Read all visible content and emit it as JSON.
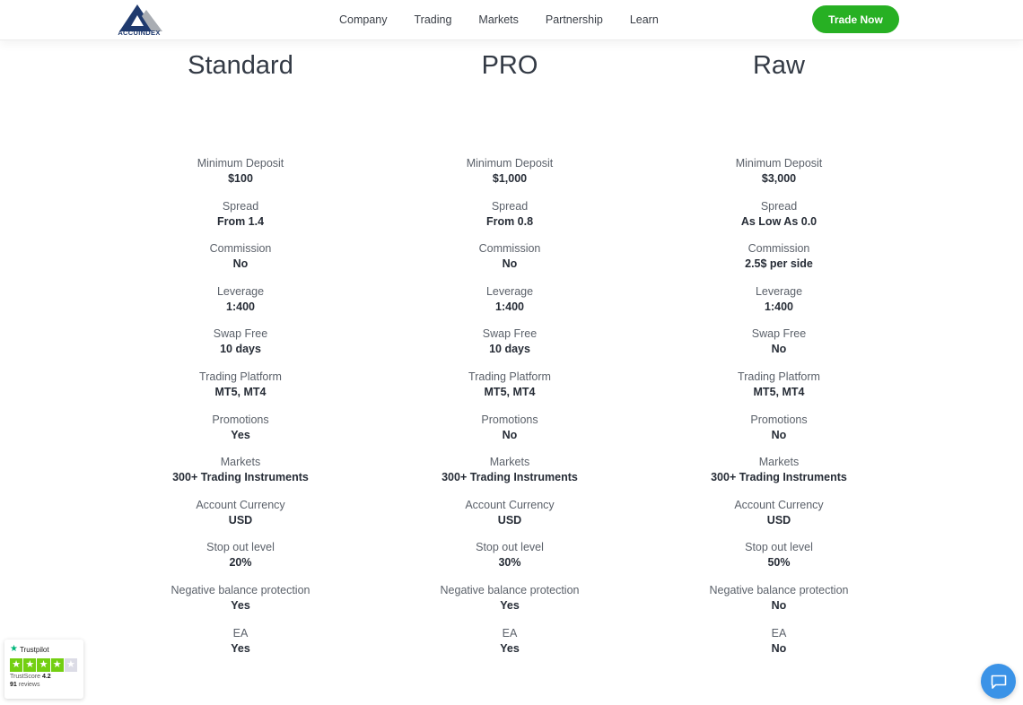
{
  "header": {
    "logo_text": "ACCUINDEX",
    "nav": [
      "Company",
      "Trading",
      "Markets",
      "Partnership",
      "Learn"
    ],
    "cta_label": "Trade Now",
    "cta_color": "#27b023"
  },
  "plans": [
    {
      "name": "Standard",
      "rows": [
        {
          "label": "Minimum Deposit",
          "value": "$100"
        },
        {
          "label": "Spread",
          "value": "From 1.4"
        },
        {
          "label": "Commission",
          "value": "No"
        },
        {
          "label": "Leverage",
          "value": "1:400"
        },
        {
          "label": "Swap Free",
          "value": "10 days"
        },
        {
          "label": "Trading Platform",
          "value": "MT5, MT4"
        },
        {
          "label": "Promotions",
          "value": "Yes"
        },
        {
          "label": "Markets",
          "value": "300+ Trading Instruments"
        },
        {
          "label": "Account Currency",
          "value": "USD"
        },
        {
          "label": "Stop out level",
          "value": "20%"
        },
        {
          "label": "Negative balance protection",
          "value": "Yes"
        },
        {
          "label": "EA",
          "value": "Yes"
        }
      ]
    },
    {
      "name": "PRO",
      "rows": [
        {
          "label": "Minimum Deposit",
          "value": "$1,000"
        },
        {
          "label": "Spread",
          "value": "From 0.8"
        },
        {
          "label": "Commission",
          "value": "No"
        },
        {
          "label": "Leverage",
          "value": "1:400"
        },
        {
          "label": "Swap Free",
          "value": "10 days"
        },
        {
          "label": "Trading Platform",
          "value": "MT5, MT4"
        },
        {
          "label": "Promotions",
          "value": "No"
        },
        {
          "label": "Markets",
          "value": "300+ Trading Instruments"
        },
        {
          "label": "Account Currency",
          "value": "USD"
        },
        {
          "label": "Stop out level",
          "value": "30%"
        },
        {
          "label": "Negative balance protection",
          "value": "Yes"
        },
        {
          "label": "EA",
          "value": "Yes"
        }
      ]
    },
    {
      "name": "Raw",
      "rows": [
        {
          "label": "Minimum Deposit",
          "value": "$3,000"
        },
        {
          "label": "Spread",
          "value": "As Low As 0.0"
        },
        {
          "label": "Commission",
          "value": "2.5$ per side"
        },
        {
          "label": "Leverage",
          "value": "1:400"
        },
        {
          "label": "Swap Free",
          "value": "No"
        },
        {
          "label": "Trading Platform",
          "value": "MT5, MT4"
        },
        {
          "label": "Promotions",
          "value": "No"
        },
        {
          "label": "Markets",
          "value": "300+ Trading Instruments"
        },
        {
          "label": "Account Currency",
          "value": "USD"
        },
        {
          "label": "Stop out level",
          "value": "50%"
        },
        {
          "label": "Negative balance protection",
          "value": "No"
        },
        {
          "label": "EA",
          "value": "No"
        }
      ]
    }
  ],
  "trustpilot": {
    "brand": "Trustpilot",
    "score_label": "TrustScore",
    "score": "4.2",
    "reviews_count": "91",
    "reviews_label": "reviews",
    "stars_filled": 4,
    "stars_total": 5
  },
  "chat": {
    "icon": "chat-bubble-icon",
    "color": "#3b93e7"
  }
}
